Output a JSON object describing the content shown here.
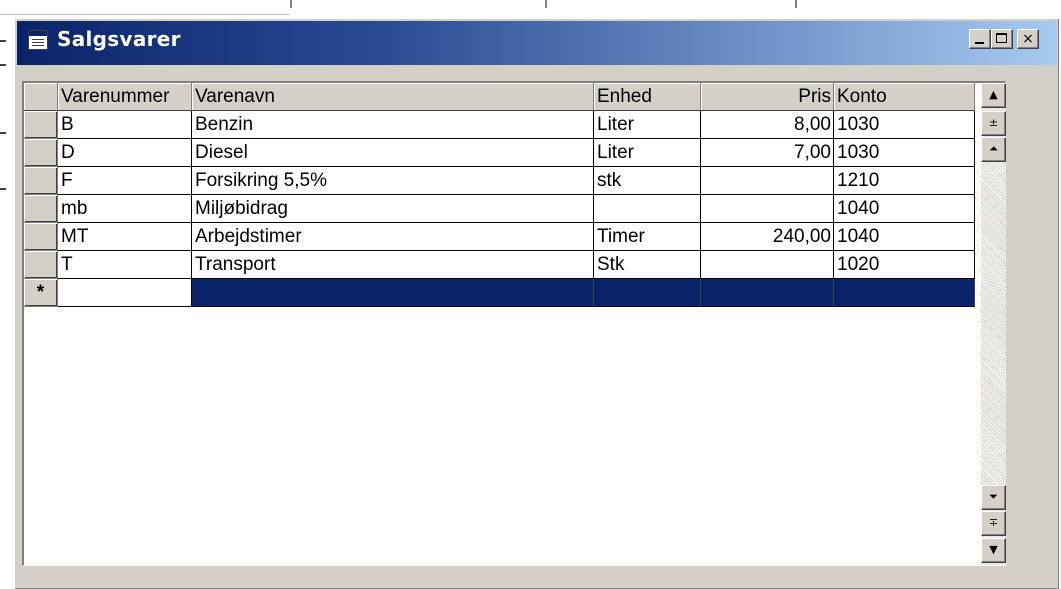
{
  "window": {
    "title": "Salgsvarer",
    "icon": "datasheet-icon",
    "buttons": {
      "minimize": "_",
      "maximize": "□",
      "close": "×"
    }
  },
  "table": {
    "columns": [
      "Varenummer",
      "Varenavn",
      "Enhed",
      "Pris",
      "Konto"
    ],
    "rows": [
      {
        "varenummer": "B",
        "varenavn": "Benzin",
        "enhed": "Liter",
        "pris": "8,00",
        "konto": "1030"
      },
      {
        "varenummer": "D",
        "varenavn": "Diesel",
        "enhed": "Liter",
        "pris": "7,00",
        "konto": "1030"
      },
      {
        "varenummer": "F",
        "varenavn": "Forsikring 5,5%",
        "enhed": "stk",
        "pris": "",
        "konto": "1210"
      },
      {
        "varenummer": "mb",
        "varenavn": "Miljøbidrag",
        "enhed": "",
        "pris": "",
        "konto": "1040"
      },
      {
        "varenummer": "MT",
        "varenavn": "Arbejdstimer",
        "enhed": "Timer",
        "pris": "240,00",
        "konto": "1040"
      },
      {
        "varenummer": "T",
        "varenavn": "Transport",
        "enhed": "Stk",
        "pris": "",
        "konto": "1020"
      }
    ],
    "new_row_marker": "*"
  },
  "scrollbar": {
    "up": "▲",
    "page_up": "±",
    "top": "⏶",
    "bottom": "⏷",
    "page_down": "∓",
    "down": "▼"
  },
  "colors": {
    "title_start": "#0a246a",
    "title_end": "#a6caf0",
    "selection": "#0a246a",
    "face": "#d4d0c8"
  }
}
